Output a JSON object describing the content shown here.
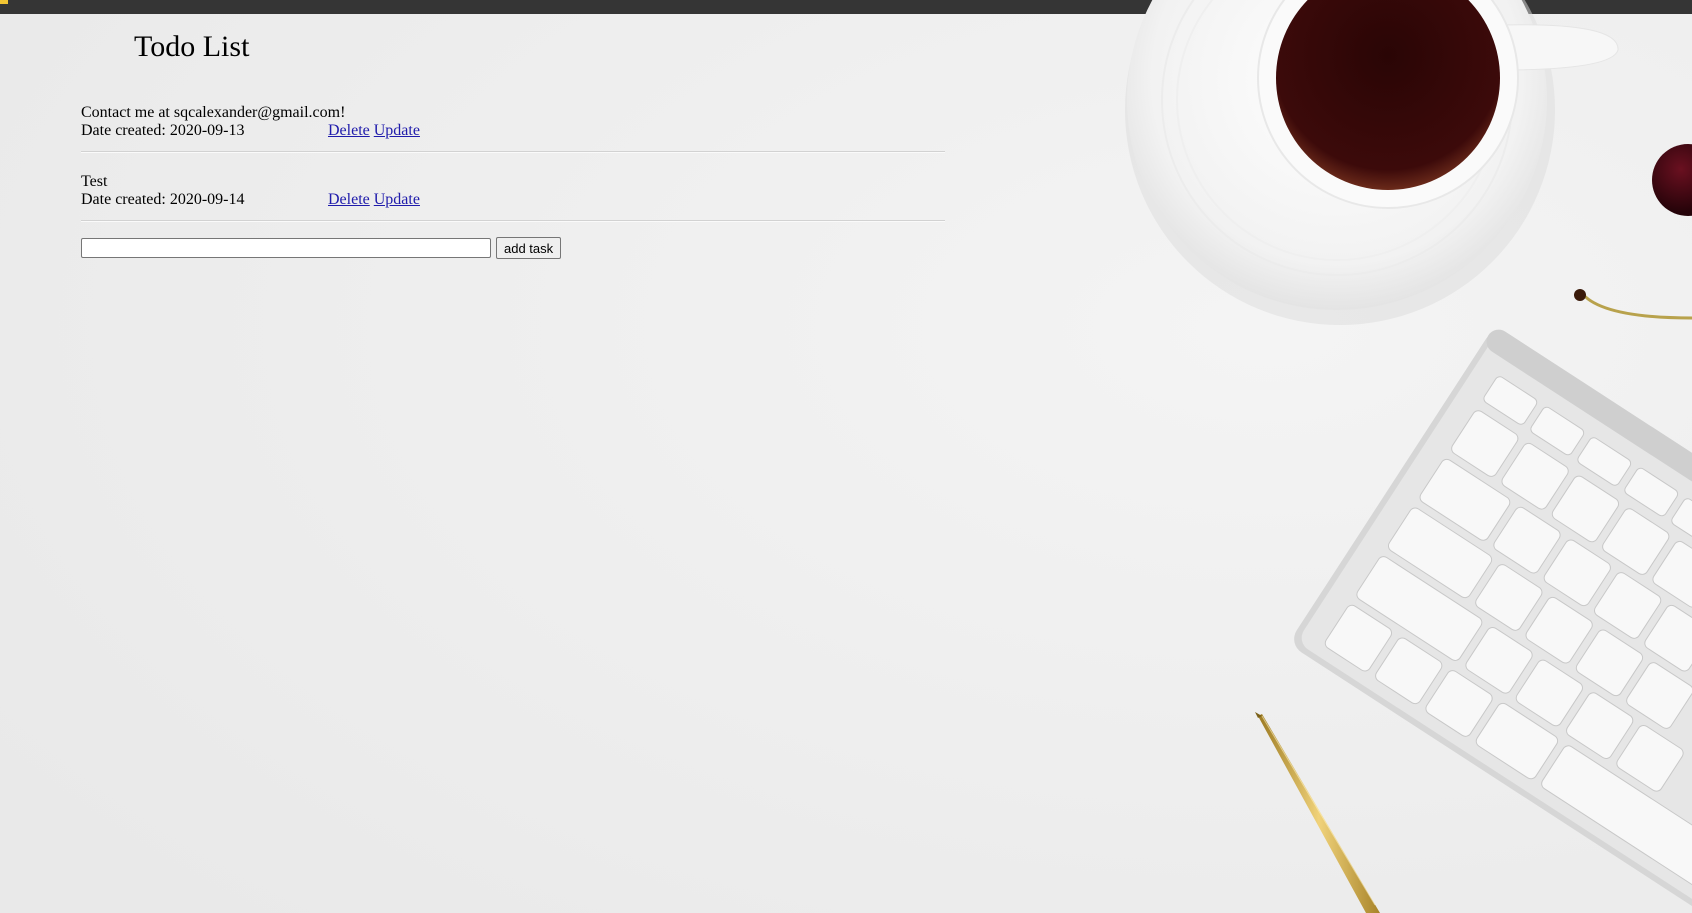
{
  "header": {
    "title": "Todo List"
  },
  "tasks": [
    {
      "content": "Contact me at sqcalexander@gmail.com!",
      "date_label": "Date created: 2020-09-13",
      "delete_label": "Delete",
      "update_label": "Update"
    },
    {
      "content": "Test",
      "date_label": "Date created: 2020-09-14",
      "delete_label": "Delete",
      "update_label": "Update"
    }
  ],
  "add_form": {
    "input_value": "",
    "button_label": "add task"
  },
  "colors": {
    "link": "#1f1bab",
    "background": "#ededed",
    "top_bar": "#353535"
  }
}
